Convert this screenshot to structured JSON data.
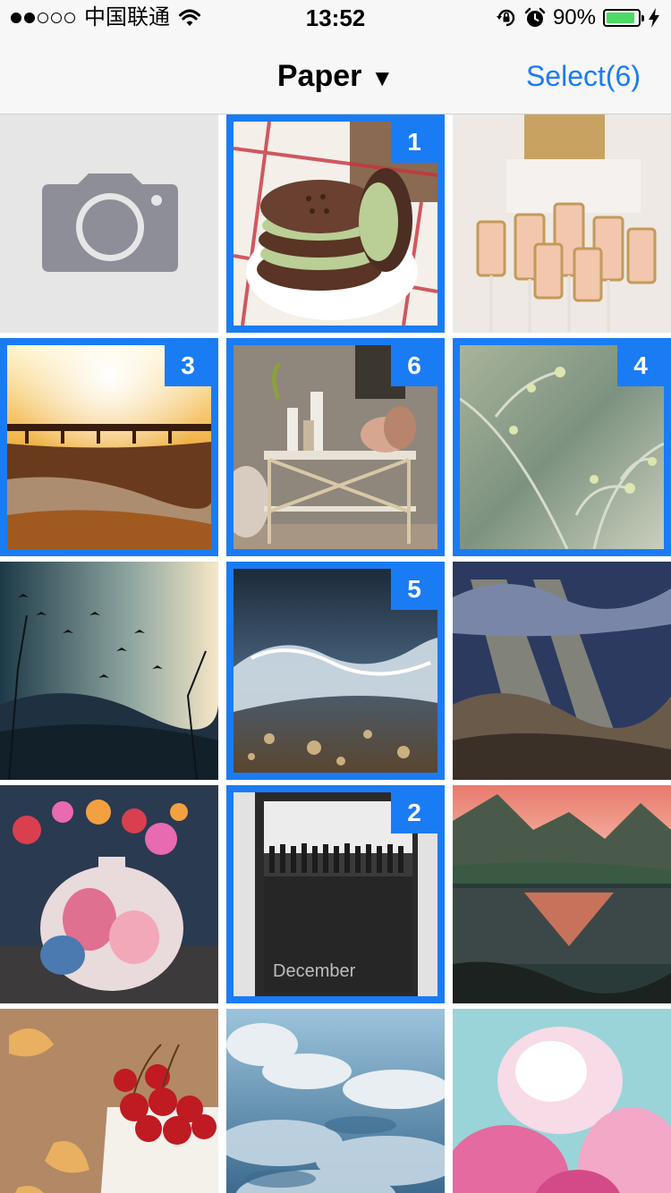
{
  "status_bar": {
    "carrier": "中国联通",
    "time": "13:52",
    "battery_percent": "90%",
    "battery_level": 0.9,
    "signal_bars": 2,
    "icons": [
      "wifi-icon",
      "rotation-lock-icon",
      "alarm-icon",
      "battery-icon",
      "charging-bolt-icon"
    ]
  },
  "nav": {
    "album_title": "Paper",
    "dropdown_glyph": "▼",
    "select_label": "Select(6)"
  },
  "colors": {
    "accent": "#1a7cf5",
    "battery": "#4cd964",
    "camera_icon": "#8e8e98"
  },
  "grid": {
    "columns": 3,
    "cells": [
      {
        "kind": "camera",
        "icon": "camera-icon"
      },
      {
        "kind": "photo",
        "subject": "ice-cream-sandwich",
        "selected": true,
        "order": "1"
      },
      {
        "kind": "photo",
        "subject": "champagne-glasses",
        "selected": false
      },
      {
        "kind": "photo",
        "subject": "sunset-pier",
        "selected": true,
        "order": "3"
      },
      {
        "kind": "photo",
        "subject": "console-table",
        "selected": true,
        "order": "6"
      },
      {
        "kind": "photo",
        "subject": "spring-branches",
        "selected": true,
        "order": "4"
      },
      {
        "kind": "photo",
        "subject": "birds-sunrays",
        "selected": false
      },
      {
        "kind": "photo",
        "subject": "water-splash",
        "selected": true,
        "order": "5"
      },
      {
        "kind": "photo",
        "subject": "sun-through-clouds",
        "selected": false
      },
      {
        "kind": "photo",
        "subject": "floral-vase-art",
        "selected": false
      },
      {
        "kind": "photo",
        "subject": "december-book",
        "selected": true,
        "order": "2",
        "text": "December"
      },
      {
        "kind": "photo",
        "subject": "mountain-lake",
        "selected": false
      },
      {
        "kind": "photo",
        "subject": "cherries",
        "selected": false
      },
      {
        "kind": "photo",
        "subject": "sea-of-clouds",
        "selected": false
      },
      {
        "kind": "photo",
        "subject": "peonies",
        "selected": false
      }
    ]
  }
}
